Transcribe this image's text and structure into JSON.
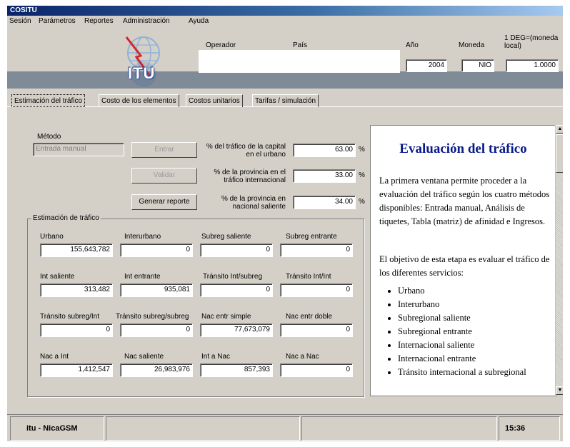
{
  "window": {
    "title": "COSITU"
  },
  "menu": [
    "Sesión",
    "Parámetros",
    "Reportes",
    "Administración",
    "Ayuda"
  ],
  "header": {
    "operator_label": "Operador",
    "country_label": "País",
    "year_label": "Año",
    "currency_label": "Moneda",
    "deg_label": "1 DEG=(moneda local)",
    "year_value": "2004",
    "currency_value": "NIO",
    "deg_value": "1.0000",
    "logo_text": "ITU"
  },
  "tabs": [
    "Estimación del tráfico",
    "Costo de los elementos",
    "Costos unitarios",
    "Tarifas / simulación"
  ],
  "method": {
    "label": "Método",
    "value": "Entrada manual",
    "enter_button": "Entrar",
    "validate_button": "Validar",
    "report_button": "Generar reporte"
  },
  "percentages": [
    {
      "label": "% del tráfico de la capital en el urbano",
      "value": "63.00",
      "unit": "%"
    },
    {
      "label": "% de la provincia en el tráfico internacional",
      "value": "33.00",
      "unit": "%"
    },
    {
      "label": "% de la provincia en nacional saliente",
      "value": "34.00",
      "unit": "%"
    }
  ],
  "traffic": {
    "group_label": "Estimación de tráfico",
    "rows": [
      [
        {
          "label": "Urbano",
          "value": "155,643,782"
        },
        {
          "label": "Interurbano",
          "value": "0"
        },
        {
          "label": "Subreg saliente",
          "value": "0"
        },
        {
          "label": "Subreg entrante",
          "value": "0"
        }
      ],
      [
        {
          "label": "Int saliente",
          "value": "313,482"
        },
        {
          "label": "Int entrante",
          "value": "935,081"
        },
        {
          "label": "Tránsito Int/subreg",
          "value": "0"
        },
        {
          "label": "Tránsito Int/Int",
          "value": "0"
        }
      ],
      [
        {
          "label": "Tránsito subreg/Int",
          "value": "0"
        },
        {
          "label": "Tránsito subreg/subreg",
          "value": "0"
        },
        {
          "label": "Nac entr simple",
          "value": "77,673,079"
        },
        {
          "label": "Nac entr doble",
          "value": "0"
        }
      ],
      [
        {
          "label": "Nac a Int",
          "value": "1,412,547"
        },
        {
          "label": "Nac saliente",
          "value": "26,983,976"
        },
        {
          "label": "Int a Nac",
          "value": "857,393"
        },
        {
          "label": "Nac a Nac",
          "value": "0"
        }
      ]
    ]
  },
  "help": {
    "title": "Evaluación del tráfico",
    "p1": "La primera ventana permite proceder a la evaluación del tráfico según los cuatro métodos disponibles: Entrada manual, Análisis de tiquetes, Tabla (matriz) de afinidad e Ingresos.",
    "p2": "El objetivo de esta etapa es evaluar el tráfico de los diferentes servicios:",
    "items": [
      "Urbano",
      "Interurbano",
      "Subregional saliente",
      "Subregional entrante",
      "Internacional saliente",
      "Internacional entrante",
      "Tránsito internacional a subregional"
    ]
  },
  "status": {
    "user": "itu - NicaGSM",
    "time": "15:36"
  }
}
